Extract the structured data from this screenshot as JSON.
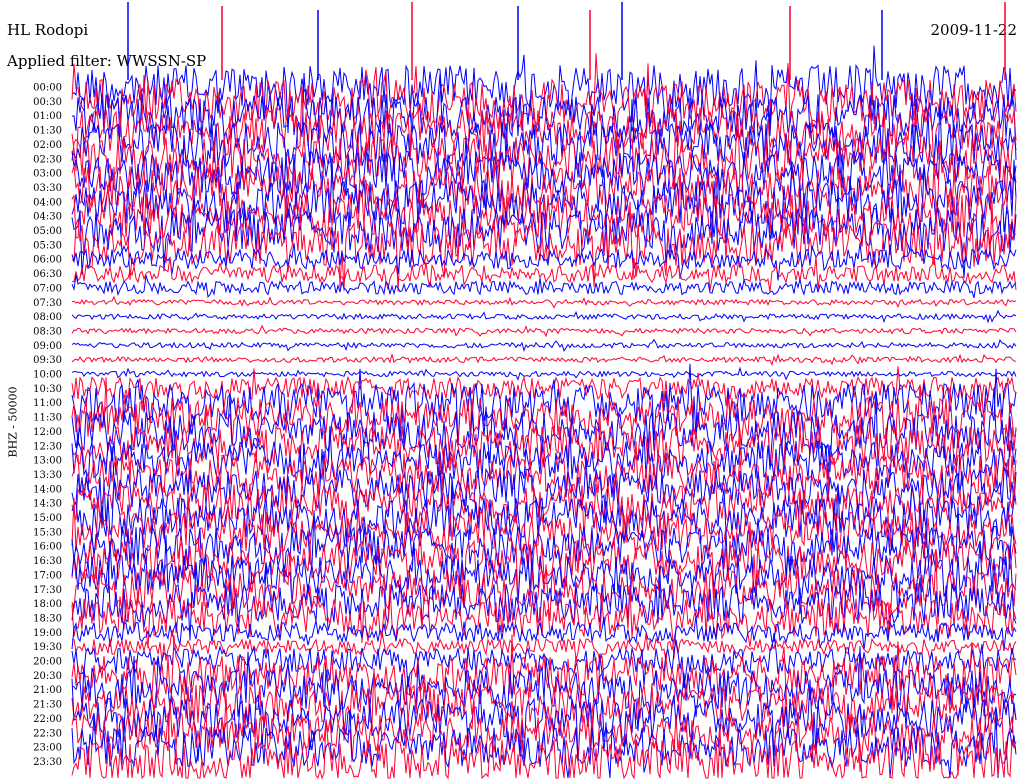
{
  "header": {
    "station": "HL Rodopi",
    "date": "2009-11-22",
    "filter": "Applied filter: WWSSN-SP"
  },
  "chart_data": {
    "type": "line",
    "title": "HL Rodopi",
    "subtitle": "Applied filter: WWSSN-SP",
    "ylabel": "BHZ - 50000",
    "xlabel": "",
    "row_labels": [
      "00:00",
      "00:30",
      "01:00",
      "01:30",
      "02:00",
      "02:30",
      "03:00",
      "03:30",
      "04:00",
      "04:30",
      "05:00",
      "05:30",
      "06:00",
      "06:30",
      "07:00",
      "07:30",
      "08:00",
      "08:30",
      "09:00",
      "09:30",
      "10:00",
      "10:30",
      "11:00",
      "11:30",
      "12:00",
      "12:30",
      "13:00",
      "13:30",
      "14:00",
      "14:30",
      "15:00",
      "15:30",
      "16:00",
      "16:30",
      "17:00",
      "17:30",
      "18:00",
      "18:30",
      "19:00",
      "19:30",
      "20:00",
      "20:30",
      "21:00",
      "21:30",
      "22:00",
      "22:30",
      "23:00",
      "23:30"
    ],
    "trace_colors": [
      "#0000ff",
      "#ff0033"
    ],
    "relative_amplitude": [
      1.0,
      1.0,
      1.0,
      1.0,
      1.0,
      1.0,
      1.0,
      1.0,
      1.0,
      1.0,
      1.0,
      1.0,
      0.45,
      0.4,
      0.3,
      0.12,
      0.12,
      0.12,
      0.12,
      0.12,
      0.12,
      0.5,
      0.9,
      0.9,
      0.9,
      0.9,
      0.9,
      0.9,
      0.9,
      0.9,
      0.9,
      0.9,
      0.9,
      0.9,
      0.9,
      0.9,
      0.9,
      0.9,
      0.45,
      0.35,
      0.6,
      0.9,
      0.9,
      0.9,
      0.9,
      0.9,
      0.9,
      1.0
    ],
    "grid": false
  }
}
